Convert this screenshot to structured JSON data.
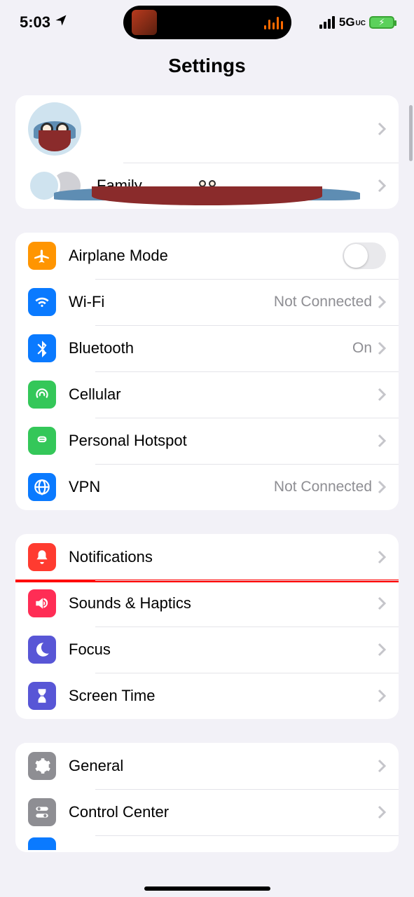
{
  "status": {
    "time": "5:03",
    "network_label": "5G",
    "network_sub": "UC"
  },
  "page": {
    "title": "Settings"
  },
  "profile": {
    "family_label": "Family"
  },
  "connectivity": {
    "airplane": "Airplane Mode",
    "wifi": "Wi-Fi",
    "wifi_value": "Not Connected",
    "bluetooth": "Bluetooth",
    "bluetooth_value": "On",
    "cellular": "Cellular",
    "hotspot": "Personal Hotspot",
    "vpn": "VPN",
    "vpn_value": "Not Connected"
  },
  "alerts": {
    "notifications": "Notifications",
    "sounds": "Sounds & Haptics",
    "focus": "Focus",
    "screentime": "Screen Time"
  },
  "general_group": {
    "general": "General",
    "control_center": "Control Center"
  }
}
